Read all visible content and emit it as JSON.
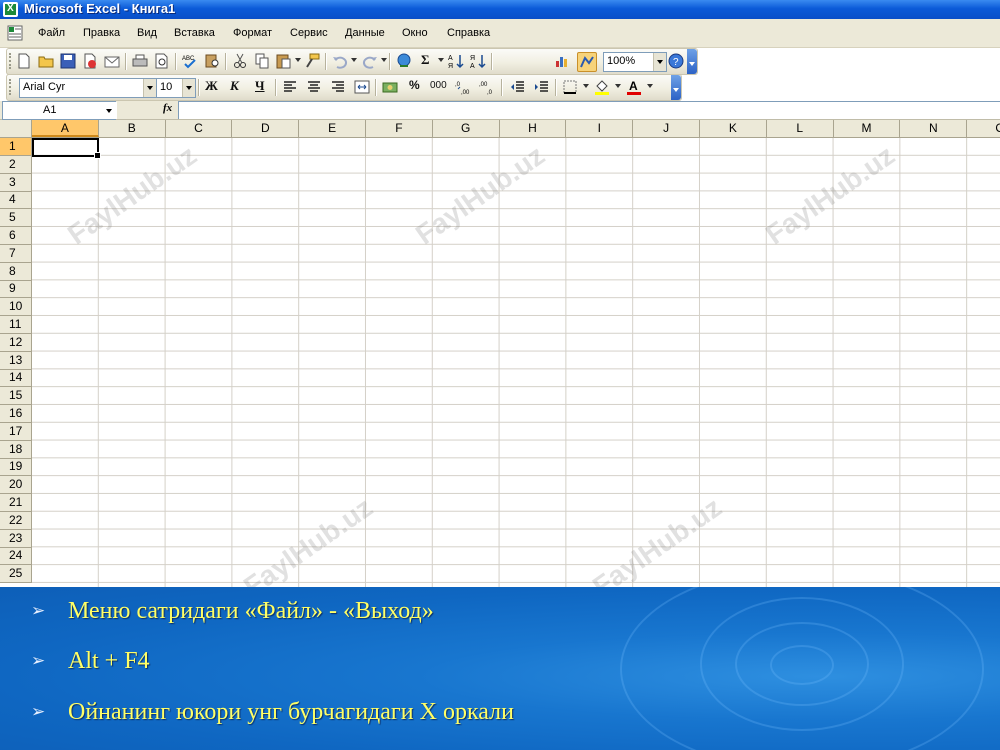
{
  "window": {
    "title": "Microsoft Excel - Книга1"
  },
  "menu": [
    "Файл",
    "Правка",
    "Вид",
    "Вставка",
    "Формат",
    "Сервис",
    "Данные",
    "Окно",
    "Справка"
  ],
  "toolbar": {
    "zoom": "100%",
    "font": "Arial Cyr",
    "size": "10",
    "bold": "Ж",
    "italic": "К",
    "underline": "Ч",
    "percent": "%",
    "thousands": "000",
    "sum": "Σ"
  },
  "formula_bar": {
    "cell_ref": "A1",
    "fx": "fx"
  },
  "grid": {
    "columns": [
      "A",
      "B",
      "C",
      "D",
      "E",
      "F",
      "G",
      "H",
      "I",
      "J",
      "K",
      "L",
      "M",
      "N",
      "O"
    ],
    "rows": [
      "1",
      "2",
      "3",
      "4",
      "5",
      "6",
      "7",
      "8",
      "9",
      "10",
      "11",
      "12",
      "13",
      "14",
      "15",
      "16",
      "17",
      "18",
      "19",
      "20",
      "21",
      "22",
      "23",
      "24",
      "25"
    ],
    "active_cell": "A1"
  },
  "watermark": "FaylHub.uz",
  "bullets": [
    "Меню сатридаги «Файл» - «Выход»",
    "Alt + F4",
    "Ойнанинг юкори унг бурчагидаги X оркали"
  ],
  "colors": {
    "slide_bg": "#1070c8",
    "bullet_text": "#ffff66",
    "titlebar": "#0b5ad8"
  }
}
